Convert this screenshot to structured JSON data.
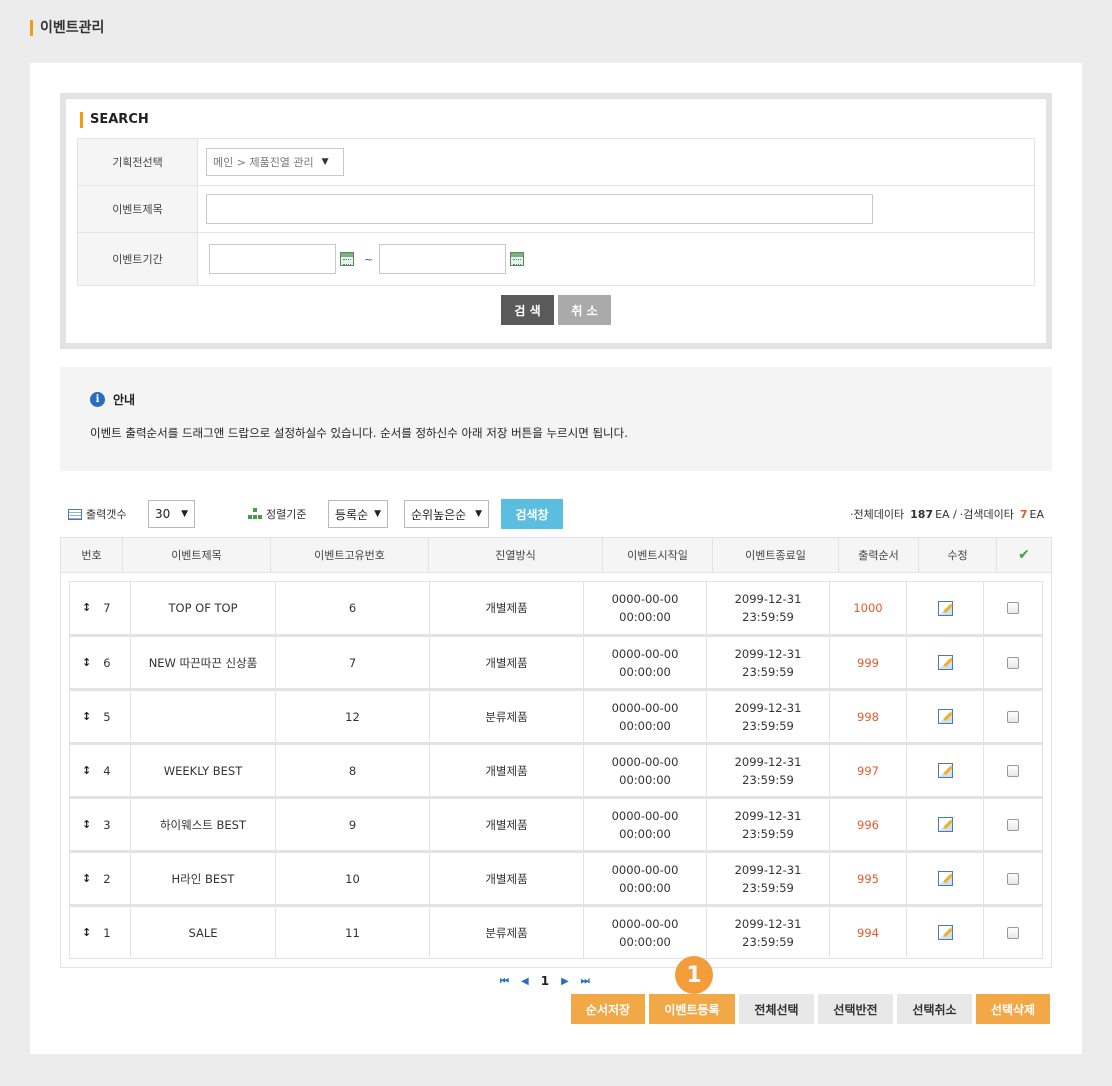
{
  "page": {
    "title": "이벤트관리"
  },
  "search": {
    "heading": "SEARCH",
    "label_plan": "기획전선택",
    "plan_value": "메인 > 제품진열 관리",
    "label_title": "이벤트제목",
    "title_value": "",
    "label_period": "이벤트기간",
    "period_start": "",
    "period_end": "",
    "tilde": "~",
    "search_btn": "검 색",
    "cancel_btn": "취 소"
  },
  "info": {
    "title": "안내",
    "icon_glyph": "i",
    "text": "이벤트 출력순서를 드래그앤 드랍으로 설정하실수 있습니다. 순서를 정하신수 아래 저장 버튼을 누르시면 됩니다."
  },
  "toolbar": {
    "count_label": "출력갯수",
    "count_value": "30",
    "sort_label": "정렬기준",
    "sort_value": "등록순",
    "order_value": "순위높은순",
    "search_window_btn": "검색창",
    "total_label": "·전체데이타",
    "total_count": "187",
    "unit1": "EA /",
    "search_label": "·검색데이타",
    "search_count": "7",
    "unit2": "EA"
  },
  "grid": {
    "headers": [
      "번호",
      "이벤트제목",
      "이벤트고유번호",
      "진열방식",
      "이벤트시작일",
      "이벤트종료일",
      "출력순서",
      "수정"
    ],
    "drag_glyph": "↕",
    "rows": [
      {
        "no": "7",
        "title": "TOP OF TOP",
        "id": "6",
        "display": "개별제품",
        "start_date": "0000-00-00",
        "start_time": "00:00:00",
        "end_date": "2099-12-31",
        "end_time": "23:59:59",
        "order": "1000"
      },
      {
        "no": "6",
        "title": "NEW 따끈따끈 신상품",
        "id": "7",
        "display": "개별제품",
        "start_date": "0000-00-00",
        "start_time": "00:00:00",
        "end_date": "2099-12-31",
        "end_time": "23:59:59",
        "order": "999"
      },
      {
        "no": "5",
        "title": "",
        "id": "12",
        "display": "분류제품",
        "start_date": "0000-00-00",
        "start_time": "00:00:00",
        "end_date": "2099-12-31",
        "end_time": "23:59:59",
        "order": "998"
      },
      {
        "no": "4",
        "title": "WEEKLY BEST",
        "id": "8",
        "display": "개별제품",
        "start_date": "0000-00-00",
        "start_time": "00:00:00",
        "end_date": "2099-12-31",
        "end_time": "23:59:59",
        "order": "997"
      },
      {
        "no": "3",
        "title": "하이웨스트 BEST",
        "id": "9",
        "display": "개별제품",
        "start_date": "0000-00-00",
        "start_time": "00:00:00",
        "end_date": "2099-12-31",
        "end_time": "23:59:59",
        "order": "996"
      },
      {
        "no": "2",
        "title": "H라인 BEST",
        "id": "10",
        "display": "개별제품",
        "start_date": "0000-00-00",
        "start_time": "00:00:00",
        "end_date": "2099-12-31",
        "end_time": "23:59:59",
        "order": "995"
      },
      {
        "no": "1",
        "title": "SALE",
        "id": "11",
        "display": "분류제품",
        "start_date": "0000-00-00",
        "start_time": "00:00:00",
        "end_date": "2099-12-31",
        "end_time": "23:59:59",
        "order": "994"
      }
    ]
  },
  "pager": {
    "current": "1"
  },
  "badge": "1",
  "actions": {
    "save_order": "순서저장",
    "register": "이벤트등록",
    "select_all": "전체선택",
    "invert": "선택반전",
    "deselect": "선택취소",
    "delete": "선택삭제"
  },
  "colors": {
    "accent": "#f39c12",
    "orange_button": "#f3a847",
    "order_text": "#e65a2a",
    "blue_button": "#5bbde0"
  }
}
